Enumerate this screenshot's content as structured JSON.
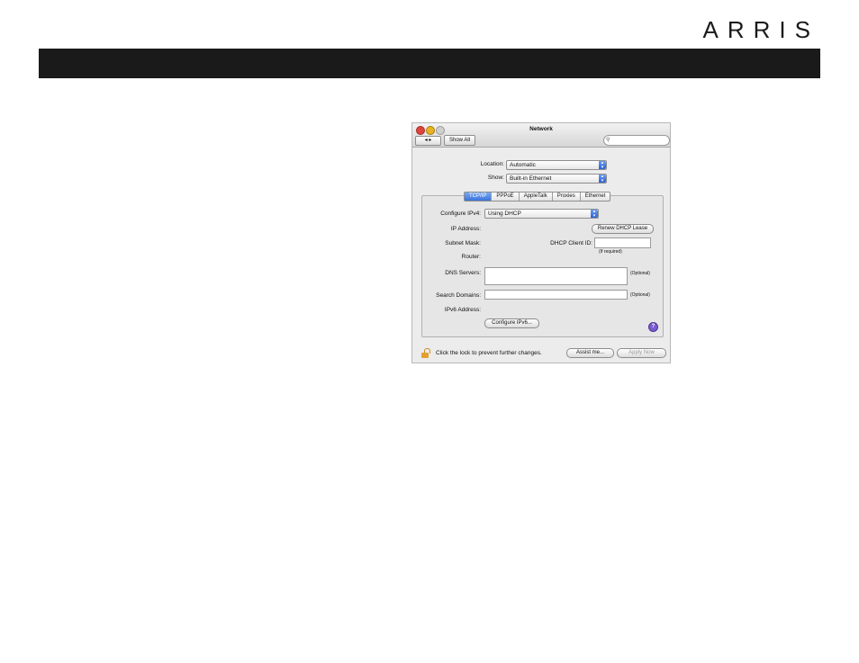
{
  "brand": {
    "logo_text": "ARRIS"
  },
  "window": {
    "title": "Network",
    "nav_label": "◂ ▸",
    "show_all_label": "Show All",
    "search": {
      "value": "",
      "placeholder": ""
    },
    "location": {
      "label": "Location:",
      "value": "Automatic"
    },
    "show": {
      "label": "Show:",
      "value": "Built-in Ethernet"
    },
    "tabs": [
      {
        "label": "TCP/IP",
        "selected": true
      },
      {
        "label": "PPPoE",
        "selected": false
      },
      {
        "label": "AppleTalk",
        "selected": false
      },
      {
        "label": "Proxies",
        "selected": false
      },
      {
        "label": "Ethernet",
        "selected": false
      }
    ],
    "configure_ipv4": {
      "label": "Configure IPv4:",
      "value": "Using DHCP"
    },
    "ip_address_label": "IP Address:",
    "renew_button": "Renew DHCP Lease",
    "subnet_mask_label": "Subnet Mask:",
    "dhcp_client_id": {
      "label": "DHCP Client ID:",
      "value": "",
      "hint": "(If required)"
    },
    "router_label": "Router:",
    "dns_servers": {
      "label": "DNS Servers:",
      "value": "",
      "hint": "(Optional)"
    },
    "search_domains": {
      "label": "Search Domains:",
      "value": "",
      "hint": "(Optional)"
    },
    "ipv6_address_label": "IPv6 Address:",
    "configure_ipv6_button": "Configure IPv6...",
    "help_label": "?",
    "lock_text": "Click the lock to prevent further changes.",
    "assist_button": "Assist me...",
    "apply_button": "Apply Now"
  }
}
